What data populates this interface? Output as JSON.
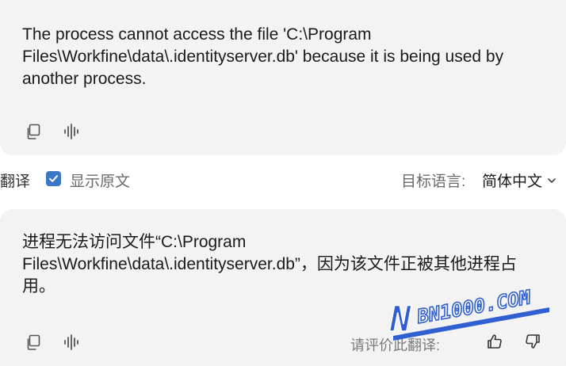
{
  "source_card": {
    "text": "The process cannot access the file 'C:\\Program Files\\Workfine\\data\\.identityserver.db' because it is being used by another process."
  },
  "options_bar": {
    "title": "翻译",
    "show_original_label": "显示原文",
    "show_original_checked": true,
    "target_language_label": "目标语言:",
    "target_language_value": "简体中文"
  },
  "result_card": {
    "text": "进程无法访问文件“C:\\Program Files\\Workfine\\data\\.identityserver.db”，因为该文件正被其他进程占用。",
    "rate_label": "请评价此翻译:"
  },
  "watermark": {
    "letter": "N",
    "text": "BN1000.COM"
  },
  "colors": {
    "card_bg": "#f3f3f3",
    "checkbox_accent": "#3a78c6",
    "watermark_blue": "#2f5fd0"
  }
}
